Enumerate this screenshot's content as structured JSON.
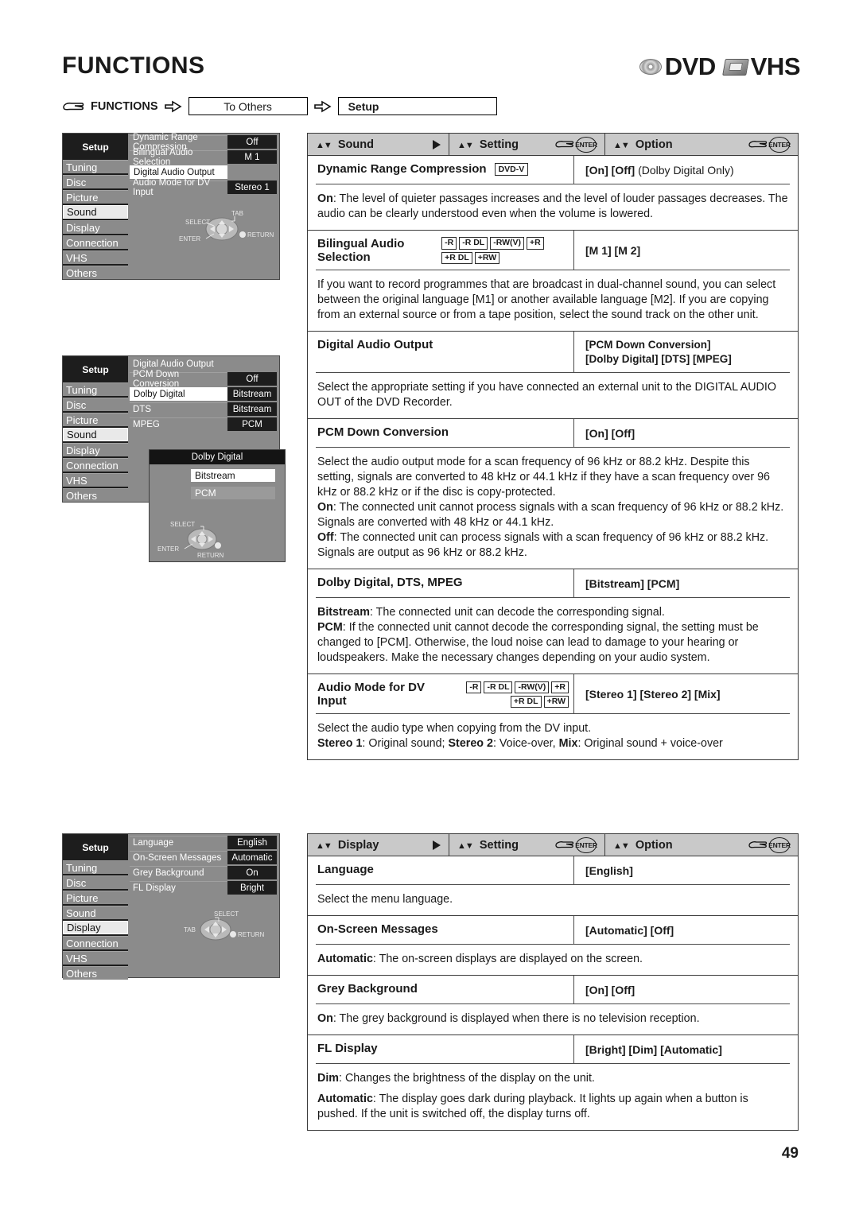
{
  "header": {
    "title": "FUNCTIONS",
    "logos": [
      {
        "icon": "dvd-disc-icon",
        "label": "DVD"
      },
      {
        "icon": "vhs-tape-icon",
        "label": "VHS"
      }
    ]
  },
  "breadcrumb": {
    "hand_icon": "pointing-hand-icon",
    "start_label": "FUNCTIONS",
    "arrow_icon": "arrow-right-icon",
    "step1": "To Others",
    "step2": "Setup"
  },
  "osd_sound": {
    "setup_title": "Setup",
    "sidebar": [
      "Tuning",
      "Disc",
      "Picture",
      "Sound",
      "Display",
      "Connection",
      "VHS",
      "Others"
    ],
    "sidebar_selected": "Sound",
    "rows": [
      {
        "label": "Dynamic Range Compression",
        "value": "Off",
        "selected": false
      },
      {
        "label": "Bilingual Audio Selection",
        "value": "M 1",
        "selected": false
      },
      {
        "label": "Digital Audio Output",
        "value": "",
        "selected": true
      },
      {
        "label": "Audio Mode for DV Input",
        "value": "Stereo 1",
        "selected": false
      }
    ],
    "navpad": {
      "select": "SELECT",
      "tab": "TAB",
      "enter": "ENTER",
      "return": "RETURN"
    }
  },
  "osd_dao": {
    "setup_title": "Setup",
    "sidebar": [
      "Tuning",
      "Disc",
      "Picture",
      "Sound",
      "Display",
      "Connection",
      "VHS",
      "Others"
    ],
    "sidebar_selected": "Sound",
    "panel_title": "Digital Audio Output",
    "rows": [
      {
        "label": "PCM Down Conversion",
        "value": "Off",
        "selected": false
      },
      {
        "label": "Dolby Digital",
        "value": "Bitstream",
        "selected": true
      },
      {
        "label": "DTS",
        "value": "Bitstream",
        "selected": false
      },
      {
        "label": "MPEG",
        "value": "PCM",
        "selected": false
      }
    ],
    "popup": {
      "title": "Dolby Digital",
      "options": [
        {
          "label": "Bitstream",
          "selected": true
        },
        {
          "label": "PCM",
          "selected": false
        }
      ],
      "navpad": {
        "select": "SELECT",
        "enter": "ENTER",
        "return": "RETURN"
      }
    }
  },
  "osd_display": {
    "setup_title": "Setup",
    "sidebar": [
      "Tuning",
      "Disc",
      "Picture",
      "Sound",
      "Display",
      "Connection",
      "VHS",
      "Others"
    ],
    "sidebar_selected": "Display",
    "rows": [
      {
        "label": "Language",
        "value": "English",
        "selected": false
      },
      {
        "label": "On-Screen Messages",
        "value": "Automatic",
        "selected": false
      },
      {
        "label": "Grey Background",
        "value": "On",
        "selected": false
      },
      {
        "label": "FL Display",
        "value": "Bright",
        "selected": false
      }
    ],
    "navpad": {
      "tab": "TAB",
      "select": "SELECT",
      "return": "RETURN"
    }
  },
  "sound_table": {
    "head": {
      "col1": "Sound",
      "col2": "Setting",
      "col3": "Option",
      "enter_label": "ENTER"
    },
    "entries": [
      {
        "title": "Dynamic Range Compression",
        "badges": [
          "DVD-V"
        ],
        "badge_style": "dvdv",
        "option_lines": [
          {
            "strong": "[On] [Off] ",
            "light": "(Dolby Digital Only)"
          }
        ],
        "body": [
          {
            "lead": "On",
            "text": ": The level of quieter passages increases and the level of louder passages decreases. The audio can be clearly understood even when the volume is lowered."
          }
        ]
      },
      {
        "title": "Bilingual Audio Selection",
        "badges": [
          "-R",
          "-R DL",
          "-RW(V)",
          "+R",
          "+R DL",
          "+RW"
        ],
        "badge_style": "discs",
        "option_lines": [
          {
            "strong": "[M 1] [M 2]",
            "light": ""
          }
        ],
        "body": [
          {
            "lead": "",
            "text": "If you want to record programmes that are broadcast in dual-channel sound, you can select between the original language [M1] or another available language [M2]. If you are copying from an external source or from a tape position, select the sound track on the other unit."
          }
        ]
      },
      {
        "title": "Digital Audio Output",
        "badges": [],
        "badge_style": "none",
        "option_lines": [
          {
            "strong": "[PCM Down Conversion]",
            "light": ""
          },
          {
            "strong": "[Dolby Digital] [DTS] [MPEG]",
            "light": ""
          }
        ],
        "body": [
          {
            "lead": "",
            "text": "Select the appropriate setting if you have connected an external unit to the DIGITAL AUDIO OUT of the DVD Recorder."
          }
        ]
      },
      {
        "title": "PCM Down Conversion",
        "badges": [],
        "badge_style": "none",
        "option_lines": [
          {
            "strong": "[On] [Off]",
            "light": ""
          }
        ],
        "body": [
          {
            "lead": "",
            "text": "Select the audio output mode for a scan frequency of 96 kHz or 88.2 kHz. Despite this setting, signals are converted to 48 kHz or 44.1 kHz if they have a scan frequency over 96 kHz or 88.2 kHz or if the disc is copy-protected."
          },
          {
            "lead": "On",
            "text": ": The connected unit cannot process signals with a scan frequency of 96 kHz or 88.2 kHz. Signals are converted with 48 kHz or 44.1 kHz."
          },
          {
            "lead": "Off",
            "text": ": The connected unit can process signals with a scan frequency of 96 kHz or 88.2 kHz. Signals are output as 96 kHz or 88.2 kHz."
          }
        ]
      },
      {
        "title": "Dolby Digital, DTS, MPEG",
        "badges": [],
        "badge_style": "none",
        "option_lines": [
          {
            "strong": "[Bitstream] [PCM]",
            "light": ""
          }
        ],
        "body": [
          {
            "lead": "Bitstream",
            "text": ": The connected unit can decode the corresponding signal."
          },
          {
            "lead": "PCM",
            "text": ": If the connected unit cannot decode the corresponding signal, the setting must be changed to [PCM]. Otherwise, the loud noise can lead to damage to your hearing or loudspeakers. Make the necessary changes depending on your audio system."
          }
        ]
      },
      {
        "title": "Audio Mode for DV Input",
        "badges": [
          "-R",
          "-R DL",
          "-RW(V)",
          "+R",
          "+R DL",
          "+RW"
        ],
        "badge_style": "discs-wrap",
        "option_lines": [
          {
            "strong": "[Stereo 1] [Stereo 2] [Mix]",
            "light": ""
          }
        ],
        "body": [
          {
            "lead": "",
            "text": "Select the audio type when copying from the DV input."
          },
          {
            "lead": "Stereo 1",
            "text": ": Original sound; ",
            "lead2": "Stereo 2",
            "text2": ": Voice-over, ",
            "lead3": "Mix",
            "text3": ": Original sound + voice-over"
          }
        ]
      }
    ]
  },
  "display_table": {
    "head": {
      "col1": "Display",
      "col2": "Setting",
      "col3": "Option",
      "enter_label": "ENTER"
    },
    "entries": [
      {
        "title": "Language",
        "option_lines": [
          {
            "strong": "[English]",
            "light": ""
          }
        ],
        "body": [
          {
            "lead": "",
            "text": "Select the menu language."
          }
        ]
      },
      {
        "title": "On-Screen Messages",
        "option_lines": [
          {
            "strong": "[Automatic] [Off]",
            "light": ""
          }
        ],
        "body": [
          {
            "lead": "Automatic",
            "text": ": The on-screen displays are displayed on the screen."
          }
        ]
      },
      {
        "title": "Grey Background",
        "option_lines": [
          {
            "strong": "[On] [Off]",
            "light": ""
          }
        ],
        "body": [
          {
            "lead": "On",
            "text": ": The grey background is displayed when there is no television reception."
          }
        ]
      },
      {
        "title": "FL Display",
        "option_lines": [
          {
            "strong": "[Bright] [Dim] [Automatic]",
            "light": ""
          }
        ],
        "body": [
          {
            "lead": "Dim",
            "text": ": Changes the brightness of the display on the unit."
          },
          {
            "lead": "Automatic",
            "text": ": The display goes dark during playback. It lights up again when a button is pushed. If the unit is switched off, the display turns off."
          }
        ]
      }
    ]
  },
  "page_number": "49"
}
